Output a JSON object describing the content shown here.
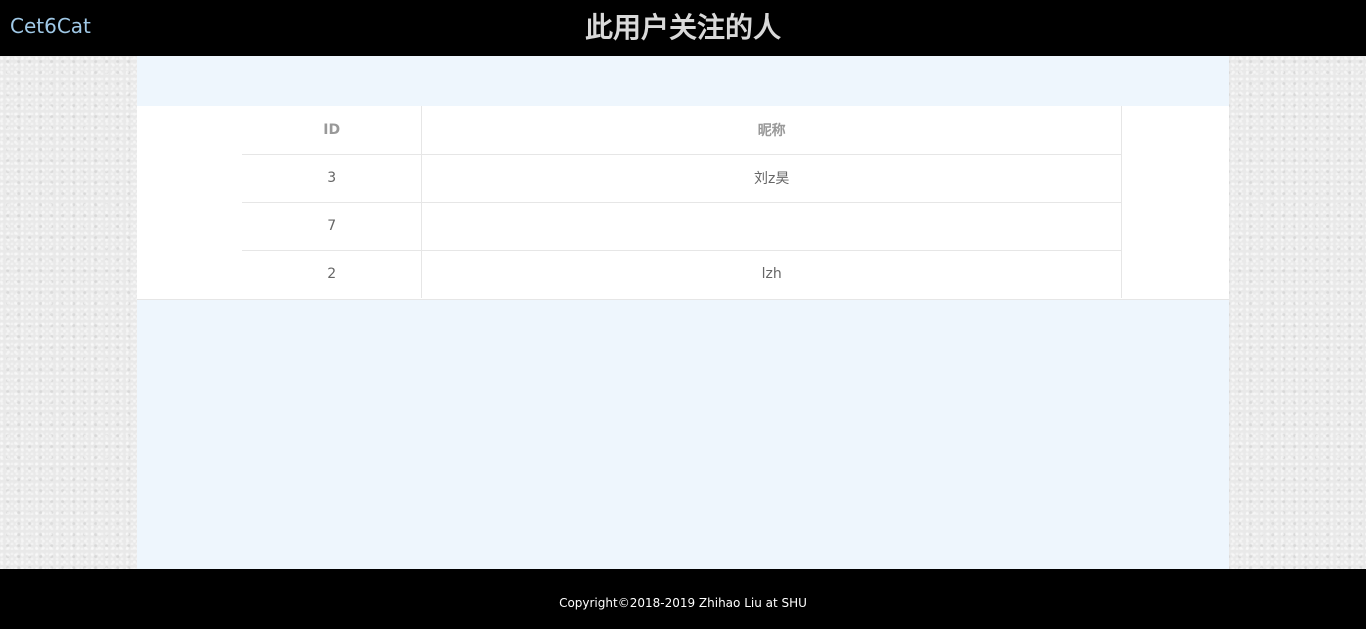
{
  "navbar": {
    "brand": "Cet6Cat",
    "title": "此用户关注的人"
  },
  "table": {
    "headers": [
      "ID",
      "昵称"
    ],
    "rows": [
      {
        "id": "3",
        "name": "刘z昊"
      },
      {
        "id": "7",
        "name": ""
      },
      {
        "id": "2",
        "name": "lzh"
      }
    ]
  },
  "footer": {
    "copyright": "Copyright©2018-2019 Zhihao Liu at SHU"
  },
  "colors": {
    "navbar_bg": "#000000",
    "brand": "#9fc8e6",
    "panel_bg": "#eef6fd"
  }
}
